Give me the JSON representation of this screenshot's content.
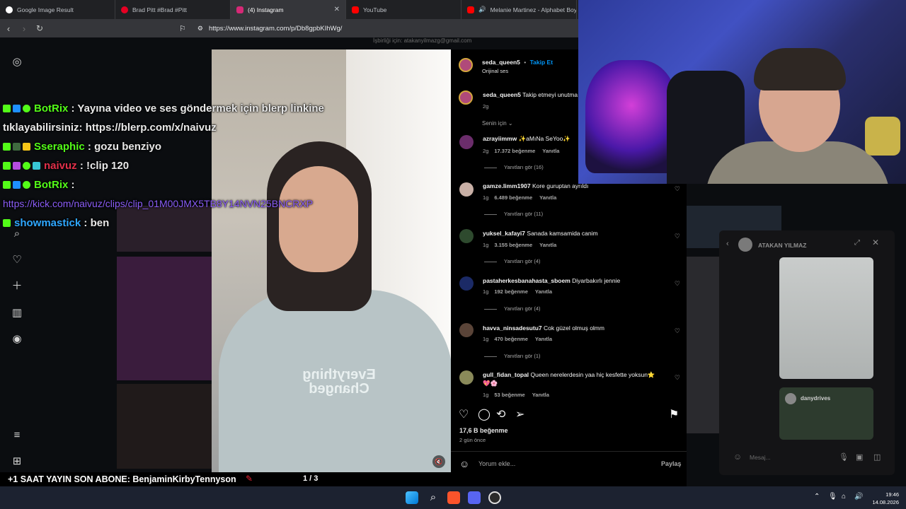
{
  "browser": {
    "tabs": [
      {
        "label": "Google Image Result",
        "favicon_color": "#ffffff",
        "active": false
      },
      {
        "label": "Brad Pitt #Brad #Pitt",
        "favicon_color": "#e60023",
        "active": false
      },
      {
        "label": "(4) Instagram",
        "favicon_color": "#d62976",
        "active": true
      },
      {
        "label": "YouTube",
        "favicon_color": "#ff0000",
        "active": false
      },
      {
        "label": "Melanie Martinez - Alphabet Boy",
        "favicon_color": "#ff0000",
        "active": false
      }
    ],
    "url": "https://www.instagram.com/p/Db8gpbKIhWg/"
  },
  "chat": {
    "messages": [
      {
        "user": "BotRix",
        "user_color": "#53fc18",
        "sep": " : ",
        "text": "Yayına video ve ses göndermek için blerp linkine tıklayabilirsiniz: https://blerp.com/x/naivuz"
      },
      {
        "user": "Sseraphic",
        "user_color": "#53fc18",
        "sep": " : ",
        "text": "gozu benziyo"
      },
      {
        "user": "naivuz",
        "user_color": "#e2304a",
        "sep": " : ",
        "text": "!clip 120"
      },
      {
        "user": "BotRix",
        "user_color": "#53fc18",
        "sep": " :",
        "text": ""
      },
      {
        "user": "",
        "user_color": "#8a5cf6",
        "sep": "",
        "text": "https://kick.com/naivuz/clips/clip_01M00JMX5TB8Y14NVN25BNCRXP"
      },
      {
        "user": "showmastick",
        "user_color": "#2fa7ff",
        "sep": " : ",
        "text": "ben"
      }
    ]
  },
  "post": {
    "author": "seda_queen5",
    "follow": "Takip Et",
    "audio": "Orijinal ses",
    "dot": "•",
    "caption_user": "seda_queen5",
    "caption": "Takip etmeyi unutma",
    "caption_time": "2g",
    "for_you": "Senin için",
    "likes": "17,6 B beğenme",
    "ago": "2 gün önce",
    "comment_placeholder": "Yorum ekle...",
    "share": "Paylaş",
    "ghost_text": "İşbirliği için: atakanyilmazg@gmail.com"
  },
  "comments": [
    {
      "user": "azrayiimmw",
      "text": "✨aMıNa SeYoo✨",
      "time": "2g",
      "likes": "17.372 beğenme",
      "reply": "Yanıtla",
      "replies": "Yanıtları gör (16)",
      "avatar_color": "#6b2d6b"
    },
    {
      "user": "gamze.limm1907",
      "text": "Kore guruptan ayrıldı",
      "time": "1g",
      "likes": "6.489 beğenme",
      "reply": "Yanıtla",
      "replies": "Yanıtları gör (11)",
      "avatar_color": "#c9b0a6"
    },
    {
      "user": "yuksel_kafayi7",
      "text": "Sanada kamsamida canim",
      "time": "1g",
      "likes": "3.155 beğenme",
      "reply": "Yanıtla",
      "replies": "Yanıtları gör (4)",
      "avatar_color": "#2e4a2e"
    },
    {
      "user": "pastaherkesbanahasta_sboem",
      "text": "Diyarbakırlı jennie",
      "time": "1g",
      "likes": "192 beğenme",
      "reply": "Yanıtla",
      "replies": "Yanıtları gör (4)",
      "avatar_color": "#1b2a66"
    },
    {
      "user": "havva_ninsadesutu7",
      "text": "Cok güzel olmuş olmm",
      "time": "1g",
      "likes": "470 beğenme",
      "reply": "Yanıtla",
      "replies": "Yanıtları gör (1)",
      "avatar_color": "#5a4438"
    },
    {
      "user": "gull_fidan_topal",
      "text": "Queen nerelerdesin yaa hiç kesfette yoksun⭐",
      "text2": "💖🌸",
      "time": "1g",
      "likes": "53 beğenme",
      "reply": "Yanıtla",
      "replies": "",
      "avatar_color": "#8a8a5a"
    }
  ],
  "dm": {
    "title": "ATAKAN YILMAZ",
    "shared_user": "danydrives",
    "input_placeholder": "Mesaj..."
  },
  "stream": {
    "sub_text": "+1 SAAT YAYIN SON ABONE: BenjaminKirbyTennyson",
    "page": "1 / 3",
    "progress": 0.33
  },
  "taskbar": {
    "time": "19:46",
    "date": "14.08.2026"
  },
  "icons": {
    "sidebar": [
      "instagram-icon",
      "search-icon",
      "heart-icon",
      "plus-icon",
      "stats-icon",
      "globe-icon",
      "menu-icon",
      "apps-icon"
    ]
  }
}
